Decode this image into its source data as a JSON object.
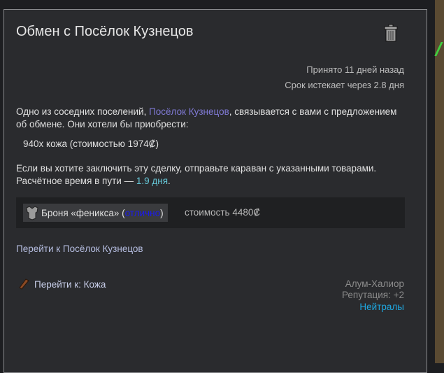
{
  "title": "Обмен с Посёлок Кузнецов",
  "accepted": "Принято 11 дней назад",
  "expires": "Срок истекает через 2.8 дня",
  "desc": {
    "p1": "Одно из соседних поселений, ",
    "settlement": "Посёлок Кузнецов",
    "p2": ", связывается с вами с предложением об обмене. Они хотели бы приобрести:"
  },
  "wanted": "940x кожа (стоимостью 1974₡)",
  "desc2": {
    "p1": "Если вы хотите заключить эту сделку, отправьте караван с указанными товарами. Расчётное время в пути — ",
    "time": "1.9 дня",
    "p2": "."
  },
  "offer": {
    "name": "Броня «феникса» (",
    "quality": "отлично",
    "close": ")",
    "cost": "стоимость 4480₡"
  },
  "goto_settlement": "Перейти к Посёлок Кузнецов",
  "goto_item": "Перейти к: Кожа",
  "faction": {
    "name": "Алум-Халиор",
    "reputation": "Репутация: +2",
    "relation": "Нейтралы"
  }
}
